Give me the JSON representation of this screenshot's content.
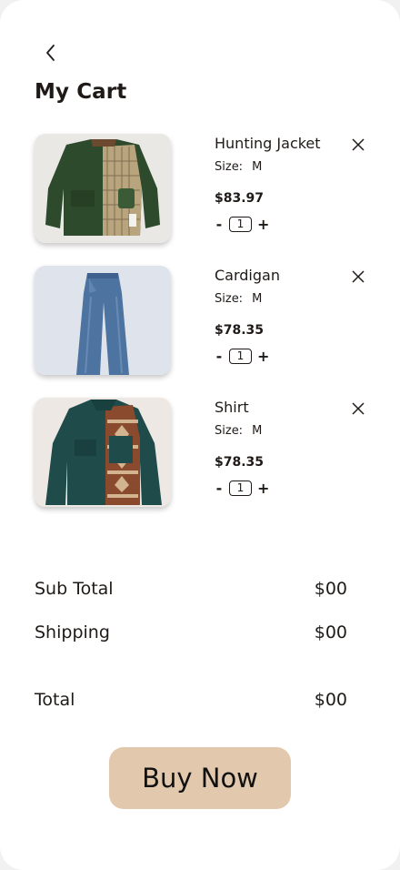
{
  "header": {
    "title": "My Cart"
  },
  "cart": {
    "items": [
      {
        "name": "Hunting Jacket",
        "size_label": "Size:",
        "size": "M",
        "price": "$83.97",
        "quantity": "1",
        "minus": "-",
        "plus": "+"
      },
      {
        "name": "Cardigan",
        "size_label": "Size:",
        "size": "M",
        "price": "$78.35",
        "quantity": "1",
        "minus": "-",
        "plus": "+"
      },
      {
        "name": "Shirt",
        "size_label": "Size:",
        "size": "M",
        "price": "$78.35",
        "quantity": "1",
        "minus": "-",
        "plus": "+"
      }
    ]
  },
  "summary": {
    "subtotal_label": "Sub Total",
    "subtotal_value": "$00",
    "shipping_label": "Shipping",
    "shipping_value": "$00",
    "total_label": "Total",
    "total_value": "$00"
  },
  "actions": {
    "buy_label": "Buy Now"
  },
  "colors": {
    "background": "#ffffff",
    "button": "#e2c8ad",
    "text": "#1f1a17"
  },
  "icons": {
    "back": "chevron-left-icon",
    "remove": "close-icon"
  }
}
